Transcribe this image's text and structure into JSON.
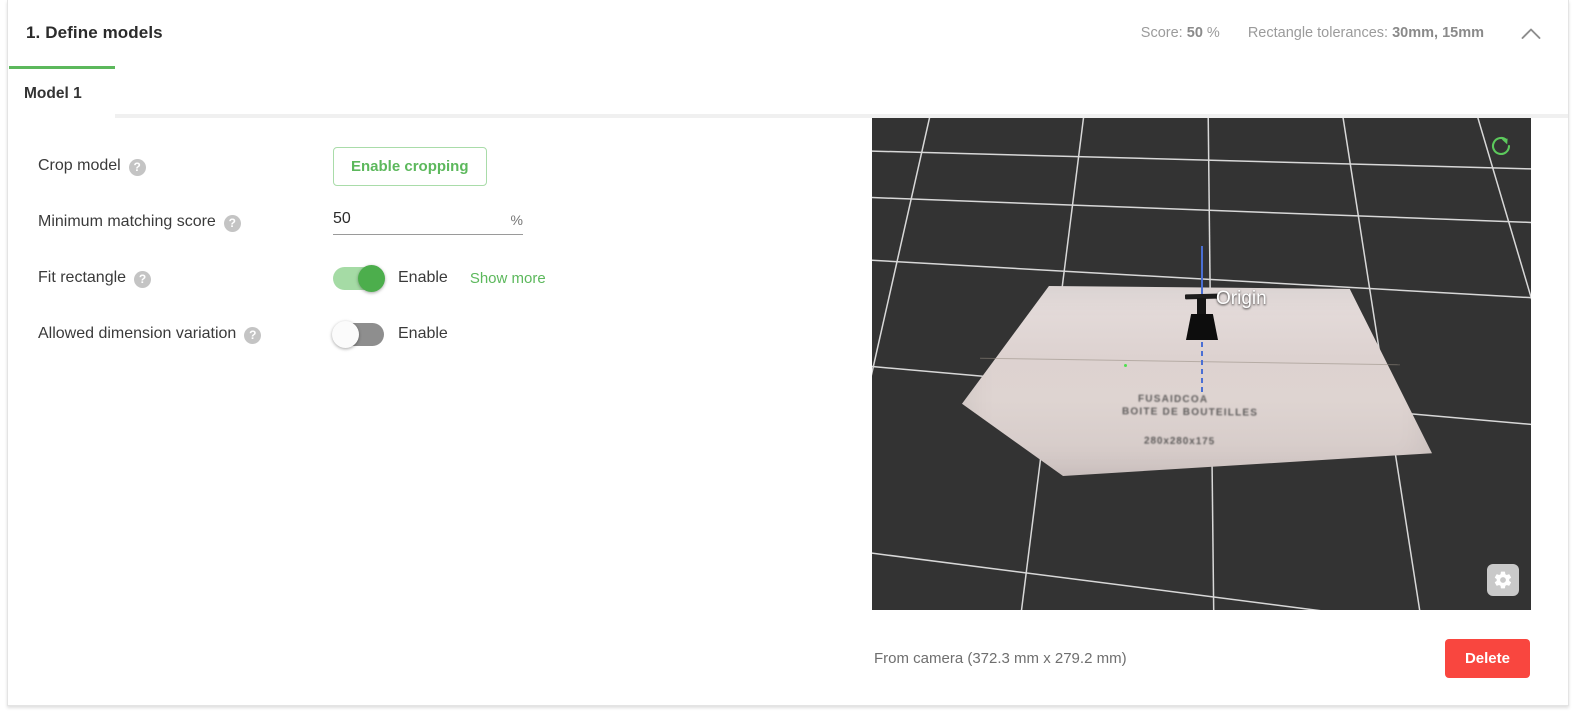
{
  "header": {
    "title": "1. Define models",
    "score_label": "Score:",
    "score_value": "50",
    "score_unit": "%",
    "tolerance_label": "Rectangle tolerances:",
    "tolerance_value": "30mm, 15mm",
    "collapse_icon": "chevron-up-icon"
  },
  "tabs": [
    {
      "label": "Model 1",
      "active": true
    }
  ],
  "form": {
    "crop_model": {
      "label": "Crop model",
      "help_icon": "help-icon",
      "button_label": "Enable cropping"
    },
    "minimum_matching_score": {
      "label": "Minimum matching score",
      "help_icon": "help-icon",
      "value": "50",
      "placeholder": "",
      "unit": "%"
    },
    "fit_rectangle": {
      "label": "Fit rectangle",
      "help_icon": "help-icon",
      "toggle_state": "on",
      "toggle_label": "Enable",
      "show_more_label": "Show more"
    },
    "allowed_dimension_variation": {
      "label": "Allowed dimension variation",
      "help_icon": "help-icon",
      "toggle_state": "off",
      "toggle_label": "Enable"
    }
  },
  "viewer": {
    "origin_label": "Origin",
    "reset_view_icon": "refresh-icon",
    "settings_icon": "gear-icon",
    "caption": "From camera (372.3 mm x 279.2 mm)",
    "delete_button": "Delete",
    "scan_text_line1": "FUSAIDCOA",
    "scan_text_line2": "BOITE DE BOUTEILLES",
    "scan_text_line3": "280x280x175"
  },
  "colors": {
    "accent_green": "#5cb85c",
    "danger_red": "#f9463f",
    "viewport_bg": "#333333",
    "muted_text": "#9b9b9b"
  }
}
